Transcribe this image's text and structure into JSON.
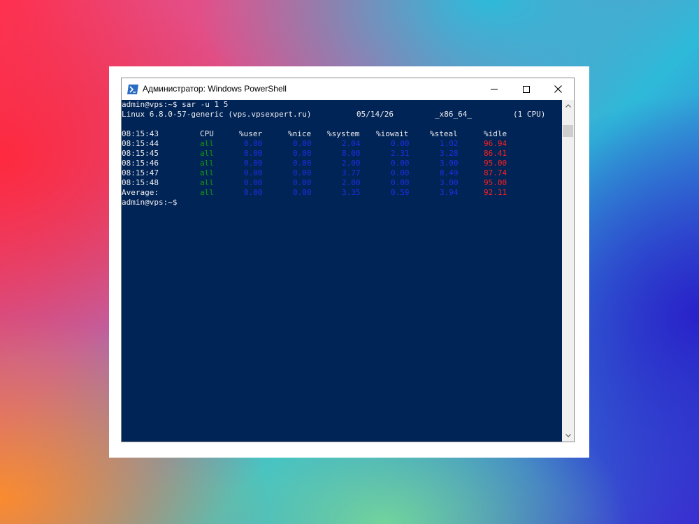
{
  "window": {
    "title": "Администратор: Windows PowerShell",
    "icon": "powershell-icon"
  },
  "terminal": {
    "command_line": "admin@vps:~$ sar -u 1 5",
    "sysinfo": {
      "kernel": "Linux 6.8.0-57-generic (vps.vpsexpert.ru)",
      "date": "05/14/26",
      "arch": "_x86_64_",
      "cpus": "(1 CPU)"
    },
    "header": {
      "time": "08:15:43",
      "cpu": "CPU",
      "user": "%user",
      "nice": "%nice",
      "system": "%system",
      "iowait": "%iowait",
      "steal": "%steal",
      "idle": "%idle"
    },
    "rows": [
      {
        "time": "08:15:44",
        "cpu": "all",
        "user": "0.00",
        "nice": "0.00",
        "system": "2.04",
        "iowait": "0.00",
        "steal": "1.02",
        "idle": "96.94"
      },
      {
        "time": "08:15:45",
        "cpu": "all",
        "user": "0.00",
        "nice": "0.00",
        "system": "8.00",
        "iowait": "2.31",
        "steal": "3.28",
        "idle": "86.41"
      },
      {
        "time": "08:15:46",
        "cpu": "all",
        "user": "0.00",
        "nice": "0.00",
        "system": "2.00",
        "iowait": "0.00",
        "steal": "3.00",
        "idle": "95.00"
      },
      {
        "time": "08:15:47",
        "cpu": "all",
        "user": "0.00",
        "nice": "0.00",
        "system": "3.77",
        "iowait": "0.00",
        "steal": "8.49",
        "idle": "87.74"
      },
      {
        "time": "08:15:48",
        "cpu": "all",
        "user": "0.00",
        "nice": "0.00",
        "system": "2.00",
        "iowait": "0.00",
        "steal": "3.00",
        "idle": "95.00"
      }
    ],
    "average": {
      "time": "Average:",
      "cpu": "all",
      "user": "0.00",
      "nice": "0.00",
      "system": "3.35",
      "iowait": "0.59",
      "steal": "3.94",
      "idle": "92.11"
    },
    "prompt": "admin@vps:~$"
  },
  "colors": {
    "console_bg": "#012456",
    "cpu_column": "#0e9a0e",
    "metric_columns": "#1e2ee6",
    "idle_column": "#ff2020"
  }
}
